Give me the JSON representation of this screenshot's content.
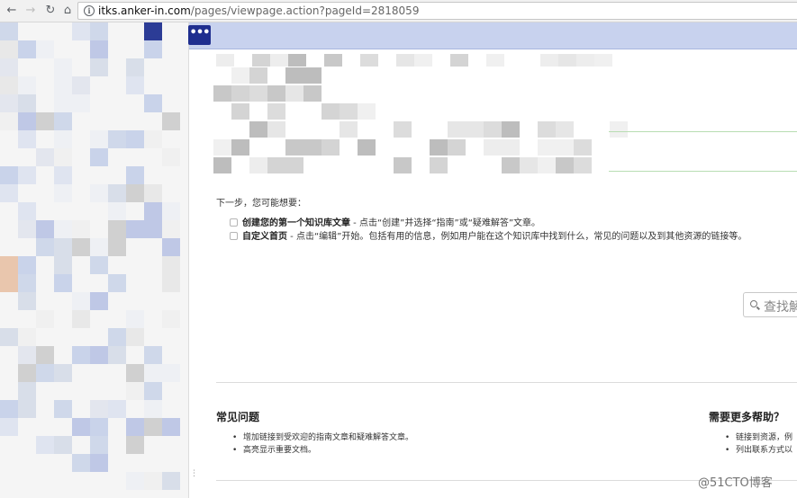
{
  "browser": {
    "url_host": "itks.anker-in.com",
    "url_path": "/pages/viewpage.action?pageId=2818059"
  },
  "header": {
    "more_label": "•••"
  },
  "content": {
    "next_steps_title": "下一步，您可能想要：",
    "tasks": [
      {
        "title": "创建您的第一个知识库文章",
        "desc": " - 点击“创建”并选择“指南”或“疑难解答”文章。"
      },
      {
        "title": "自定义首页",
        "desc": " - 点击“编辑”开始。包括有用的信息，例如用户能在这个知识库中找到什么，常见的问题以及到其他资源的链接等。"
      }
    ],
    "search_placeholder": "查找解"
  },
  "faq": {
    "title": "常见问题",
    "items": [
      "增加链接到受欢迎的指南文章和疑难解答文章。",
      "高亮显示重要文档。"
    ]
  },
  "help": {
    "title": "需要更多帮助？",
    "items": [
      "链接到资源，例",
      "列出联系方式以"
    ]
  },
  "watermark": "@51CTO博客",
  "colors": {
    "header_bar": "#c8d2ee",
    "more_button": "#1f2e8f",
    "sidebar_bg": "#f5f5f5"
  }
}
